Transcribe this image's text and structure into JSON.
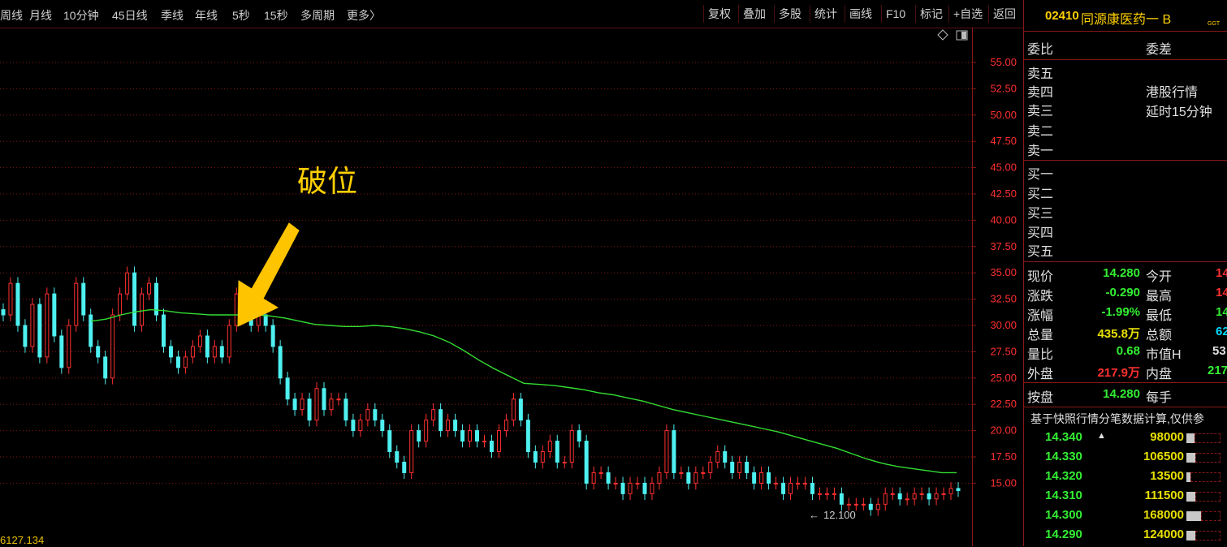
{
  "toolbar": {
    "periods": [
      "周线",
      "月线",
      "10分钟",
      "45日线",
      "季线",
      "年线",
      "5秒",
      "15秒",
      "多周期",
      "更多〉"
    ],
    "tools": [
      "复权",
      "叠加",
      "多股",
      "统计",
      "画线",
      "F10",
      "标记",
      "+自选",
      "返回"
    ],
    "icons": [
      "diamond-icon",
      "panel-toggle-icon"
    ]
  },
  "chart": {
    "y_ticks": [
      "55.00",
      "52.50",
      "50.00",
      "47.50",
      "45.00",
      "42.50",
      "40.00",
      "37.50",
      "35.00",
      "32.50",
      "30.00",
      "27.50",
      "25.00",
      "22.50",
      "20.00",
      "17.50",
      "15.00"
    ],
    "low_label": "12.100",
    "annotation": "破位",
    "bottom_value": "6127.134",
    "colors": {
      "up": "#ff3030",
      "down": "#4ff0f0",
      "ma": "#33dd33",
      "arrow": "#ffc400",
      "grid": "#8a1818"
    },
    "ma_series": [
      30.4,
      30.6,
      31.0,
      31.3,
      31.5,
      31.4,
      31.2,
      31.1,
      31.0,
      31.0,
      31.0,
      31.0,
      30.9,
      30.7,
      30.4,
      30.1,
      30.0,
      29.9,
      29.9,
      30.0,
      29.9,
      29.7,
      29.4,
      29.0,
      28.4,
      27.6,
      26.7,
      25.9,
      25.2,
      24.5,
      24.4,
      24.3,
      24.1,
      23.9,
      23.6,
      23.4,
      23.1,
      22.8,
      22.4,
      22.0,
      21.7,
      21.4,
      21.1,
      20.8,
      20.5,
      20.2,
      19.9,
      19.5,
      19.1,
      18.7,
      18.3,
      17.8,
      17.3,
      16.9,
      16.6,
      16.4,
      16.2,
      16.0,
      16.0
    ],
    "candle_closes": [
      31,
      34,
      30,
      28,
      32,
      27,
      33,
      29,
      26,
      30,
      34,
      31,
      28,
      27,
      25,
      31,
      33,
      35,
      30,
      33,
      34,
      31,
      28,
      27,
      26,
      27,
      28,
      29,
      27,
      28,
      27,
      30,
      33,
      31,
      30,
      31,
      30,
      28,
      25,
      23,
      22,
      23,
      21,
      24,
      22,
      23,
      23,
      21,
      20,
      21,
      22,
      21,
      20,
      18,
      17,
      16,
      20,
      19,
      21,
      22,
      20,
      21,
      20,
      19,
      20,
      19,
      19,
      18,
      20,
      21,
      23,
      21,
      18,
      17,
      18,
      19,
      17,
      17,
      20,
      19,
      15,
      16,
      16,
      15,
      15,
      14,
      15,
      15,
      14,
      15,
      16,
      20,
      16,
      16,
      15,
      16,
      16,
      17,
      18,
      17,
      16,
      17,
      16,
      15,
      16,
      15,
      15,
      14,
      15,
      15,
      15,
      14,
      14,
      14,
      14,
      13,
      13,
      13,
      13,
      12.5,
      13,
      14,
      14,
      13.5,
      13.5,
      14,
      14,
      13.5,
      14,
      14,
      14.5,
      14.3
    ]
  },
  "stock": {
    "code": "02410",
    "name": "同源康医药一 B",
    "tag": "GGT"
  },
  "order_book": {
    "header_left": "委比",
    "header_right": "委差",
    "asks": [
      "卖五",
      "卖四",
      "卖三",
      "卖二",
      "卖一"
    ],
    "bids": [
      "买一",
      "买二",
      "买三",
      "买四",
      "买五"
    ],
    "notice_line1": "港股行情",
    "notice_line2": "延时15分钟"
  },
  "quote": {
    "rows": [
      {
        "l1": "现价",
        "v1": "14.280",
        "c1": "green",
        "l2": "今开",
        "v2": "14",
        "c2": "red"
      },
      {
        "l1": "涨跌",
        "v1": "-0.290",
        "c1": "green",
        "l2": "最高",
        "v2": "14",
        "c2": "red"
      },
      {
        "l1": "涨幅",
        "v1": "-1.99%",
        "c1": "green",
        "l2": "最低",
        "v2": "14",
        "c2": "green"
      },
      {
        "l1": "总量",
        "v1": "435.8万",
        "c1": "yellow",
        "l2": "总额",
        "v2": "62",
        "c2": "cyan"
      },
      {
        "l1": "量比",
        "v1": "0.68",
        "c1": "green",
        "l2": "市值H",
        "v2": "53",
        "c2": "white"
      },
      {
        "l1": "外盘",
        "v1": "217.9万",
        "c1": "red",
        "l2": "内盘",
        "v2": "217",
        "c2": "green"
      }
    ],
    "close_row": {
      "l1": "按盘",
      "v1": "14.280",
      "l2": "每手"
    }
  },
  "ticks": {
    "note": "基于快照行情分笔数据计算,仅供参",
    "rows": [
      {
        "price": "14.340",
        "marker": "▲",
        "vol": "98000",
        "level": 0.16
      },
      {
        "price": "14.330",
        "marker": "",
        "vol": "106500",
        "level": 0.18
      },
      {
        "price": "14.320",
        "marker": "",
        "vol": "13500",
        "level": 0.05
      },
      {
        "price": "14.310",
        "marker": "",
        "vol": "111500",
        "level": 0.18
      },
      {
        "price": "14.300",
        "marker": "",
        "vol": "168000",
        "level": 0.3
      },
      {
        "price": "14.290",
        "marker": "",
        "vol": "124000",
        "level": 0.18
      }
    ]
  }
}
